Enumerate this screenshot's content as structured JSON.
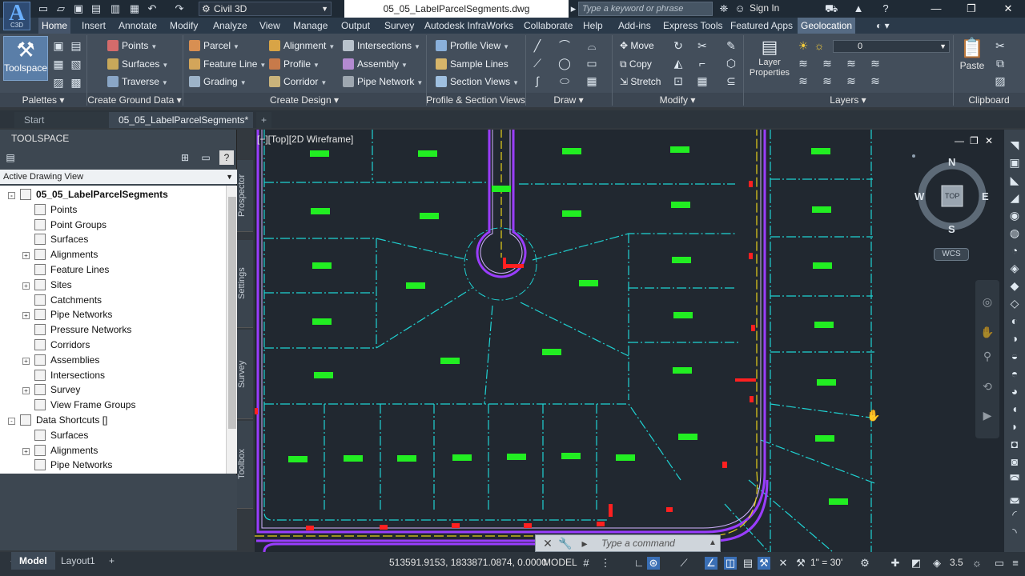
{
  "app": {
    "logo_letter": "A",
    "logo_sub": "C3D"
  },
  "titlebar": {
    "workspace": "Civil 3D",
    "document": "05_05_LabelParcelSegments.dwg",
    "search_placeholder": "Type a keyword or phrase",
    "signin": "Sign In"
  },
  "ribbon_tabs": [
    "Home",
    "Insert",
    "Annotate",
    "Modify",
    "Analyze",
    "View",
    "Manage",
    "Output",
    "Survey",
    "Autodesk InfraWorks",
    "Collaborate",
    "Help",
    "Add-ins",
    "Express Tools",
    "Featured Apps",
    "Geolocation"
  ],
  "ribbon": {
    "toolspace_label": "Toolspace",
    "ground": [
      "Points",
      "Surfaces",
      "Traverse"
    ],
    "design_col1": [
      "Parcel",
      "Feature Line",
      "Grading"
    ],
    "design_col2": [
      "Alignment",
      "Profile",
      "Corridor"
    ],
    "design_col3": [
      "Intersections",
      "Assembly",
      "Pipe Network"
    ],
    "profile": [
      "Profile View",
      "Sample Lines",
      "Section Views"
    ],
    "modify": [
      "Move",
      "Copy",
      "Stretch"
    ],
    "layer_properties": "Layer Properties",
    "layer_value": "0",
    "paste": "Paste",
    "panels": [
      "Palettes",
      "Create Ground Data",
      "Create Design",
      "Profile & Section Views",
      "Draw",
      "Modify",
      "Layers",
      "Clipboard"
    ]
  },
  "doctabs": {
    "start": "Start",
    "active": "05_05_LabelParcelSegments*",
    "add": "+"
  },
  "toolspace": {
    "title": "TOOLSPACE",
    "view": "Active Drawing View",
    "tree": [
      {
        "label": "05_05_LabelParcelSegments",
        "level": 0,
        "expand": "-",
        "bold": true
      },
      {
        "label": "Points",
        "level": 1,
        "expand": ""
      },
      {
        "label": "Point Groups",
        "level": 1,
        "expand": ""
      },
      {
        "label": "Surfaces",
        "level": 1,
        "expand": ""
      },
      {
        "label": "Alignments",
        "level": 1,
        "expand": "+"
      },
      {
        "label": "Feature Lines",
        "level": 1,
        "expand": ""
      },
      {
        "label": "Sites",
        "level": 1,
        "expand": "+"
      },
      {
        "label": "Catchments",
        "level": 1,
        "expand": ""
      },
      {
        "label": "Pipe Networks",
        "level": 1,
        "expand": "+"
      },
      {
        "label": "Pressure Networks",
        "level": 1,
        "expand": ""
      },
      {
        "label": "Corridors",
        "level": 1,
        "expand": ""
      },
      {
        "label": "Assemblies",
        "level": 1,
        "expand": "+"
      },
      {
        "label": "Intersections",
        "level": 1,
        "expand": ""
      },
      {
        "label": "Survey",
        "level": 1,
        "expand": "+"
      },
      {
        "label": "View Frame Groups",
        "level": 1,
        "expand": ""
      },
      {
        "label": "Data Shortcuts []",
        "level": 0,
        "expand": "-"
      },
      {
        "label": "Surfaces",
        "level": 1,
        "expand": ""
      },
      {
        "label": "Alignments",
        "level": 1,
        "expand": "+"
      },
      {
        "label": "Pipe Networks",
        "level": 1,
        "expand": ""
      }
    ],
    "side_tabs": [
      "Prospector",
      "Settings",
      "Survey",
      "Toolbox"
    ]
  },
  "viewport": {
    "label": "[−][Top][2D Wireframe]",
    "compass": {
      "n": "N",
      "s": "S",
      "e": "E",
      "w": "W",
      "top": "TOP"
    },
    "wcs": "WCS"
  },
  "command": {
    "placeholder": "Type a command"
  },
  "status": {
    "layout_tabs": [
      "Model",
      "Layout1"
    ],
    "coords": "513591.9153, 1833871.0874, 0.0000",
    "model": "MODEL",
    "scale": "1\" = 30'",
    "zoom": "3.5"
  },
  "colors": {
    "background": "#212830",
    "parcel_lines": "#1fd3d3",
    "road": "#9a3dff",
    "centerline": "#e8d21a",
    "labels": "#22ee22",
    "markers": "#ff2020"
  }
}
